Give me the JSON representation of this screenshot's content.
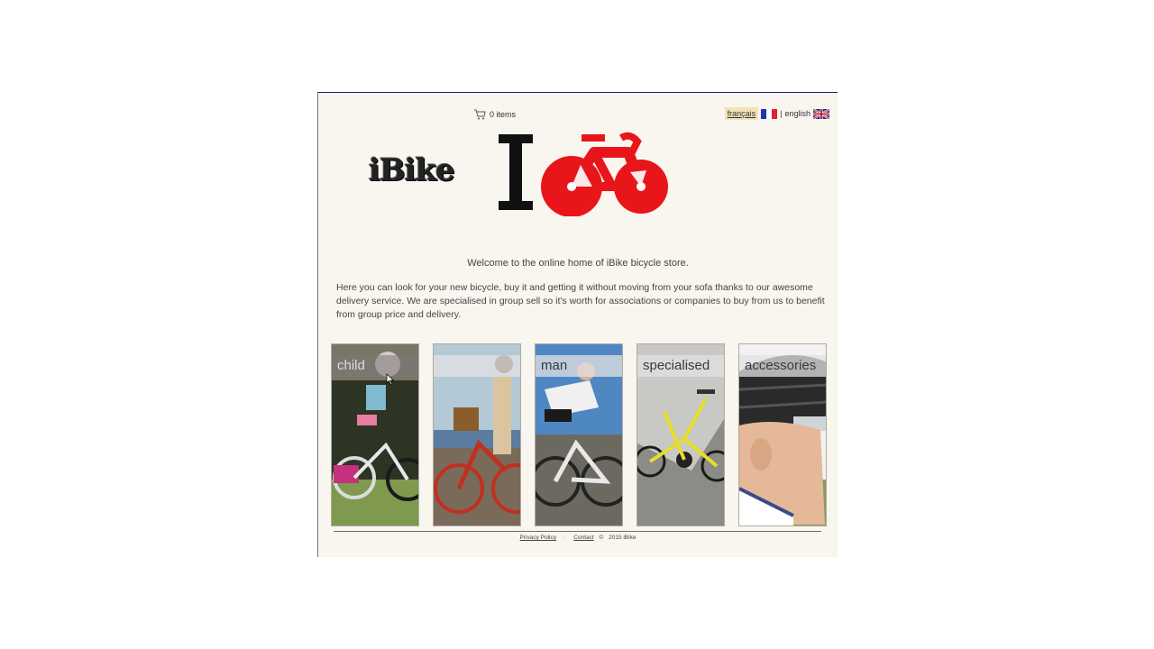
{
  "cart": {
    "label": "0 items"
  },
  "language": {
    "french": "français",
    "separator": "|",
    "english": "english"
  },
  "logo": {
    "text": "iBike"
  },
  "welcome": "Welcome to the online home of iBike bicycle store.",
  "intro": "Here you can look for your new bicycle, buy it and getting it without moving from your sofa thanks to our awesome delivery service. We are specialised in group sell so it's worth for associations or companies to buy from us to benefit from group price and delivery.",
  "categories": [
    {
      "label": "child"
    },
    {
      "label": ""
    },
    {
      "label": "man"
    },
    {
      "label": "specialised"
    },
    {
      "label": "accessories"
    }
  ],
  "footer": {
    "privacy": "Privacy Policy",
    "contact": "Contact",
    "copyright": "©",
    "year_brand": "2015 iBike"
  },
  "colors": {
    "page_bg": "#f9f5ef",
    "logo_red": "#e8161b",
    "border_top": "#1b1b66"
  },
  "icons": [
    "cart-icon",
    "france-flag-icon",
    "uk-flag-icon",
    "bicycle-logo-icon",
    "cursor-icon"
  ]
}
